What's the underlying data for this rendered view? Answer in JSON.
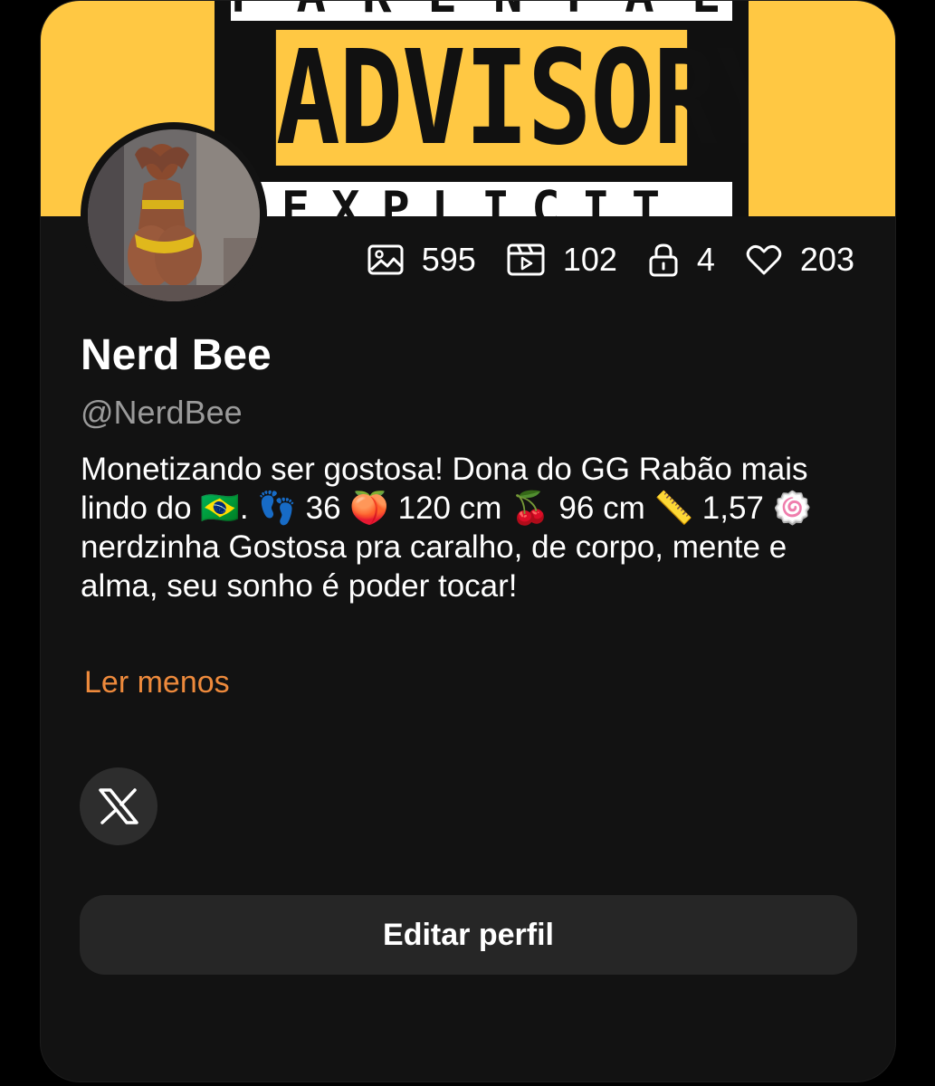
{
  "banner": {
    "top_text": "PARENTAL",
    "main_text": "ADVISORY",
    "bottom_text": "EXPLICIT CONTENT",
    "background_color": "#ffc843"
  },
  "profile": {
    "name": "Nerd Bee",
    "handle": "@NerdBee",
    "bio": "Monetizando ser gostosa! Dona do GG Rabão mais lindo do 🇧🇷. 👣 36 🍑 120 cm 🍒 96 cm 📏 1,57 🍥 nerdzinha Gostosa pra caralho, de corpo, mente e alma, seu sonho é poder tocar!",
    "read_less_label": "Ler menos"
  },
  "stats": {
    "photos": "595",
    "videos": "102",
    "locked": "4",
    "likes": "203",
    "photos_icon": "image-icon",
    "videos_icon": "video-clapper-icon",
    "locked_icon": "lock-icon",
    "likes_icon": "heart-icon"
  },
  "social": {
    "x_icon": "x-logo-icon"
  },
  "actions": {
    "edit_profile_label": "Editar perfil"
  },
  "colors": {
    "card_background": "#121212",
    "accent_orange": "#ee8a3c",
    "button_background": "#262626"
  }
}
